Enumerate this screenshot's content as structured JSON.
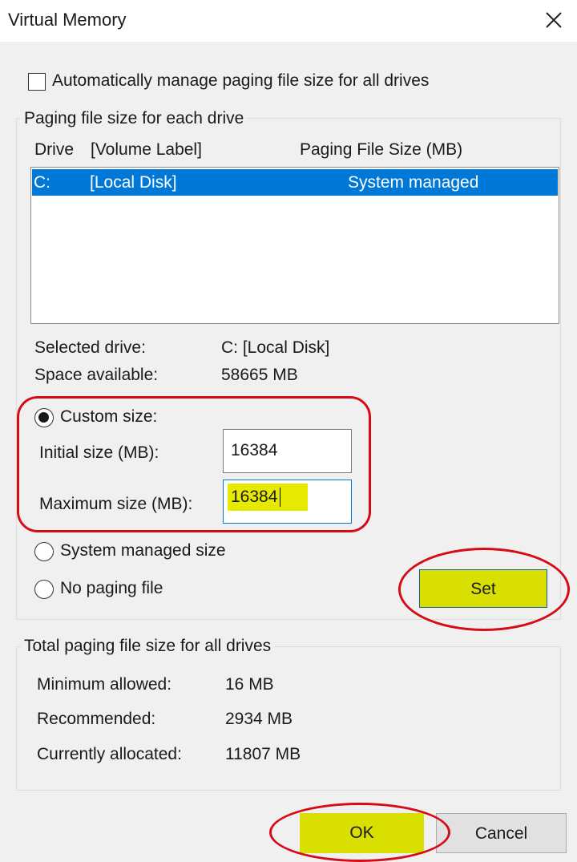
{
  "window": {
    "title": "Virtual Memory",
    "close_icon": "close-icon"
  },
  "auto_manage": {
    "label": "Automatically manage paging file size for all drives",
    "checked": false
  },
  "per_drive": {
    "group_title": "Paging file size for each drive",
    "columns": {
      "drive": "Drive",
      "volume_label": "[Volume Label]",
      "size": "Paging File Size (MB)"
    },
    "rows": [
      {
        "drive": "C:",
        "label": "[Local Disk]",
        "size": "System managed",
        "selected": true
      }
    ],
    "selected_drive_label": "Selected drive:",
    "selected_drive_value": "C:  [Local Disk]",
    "space_available_label": "Space available:",
    "space_available_value": "58665 MB",
    "custom_size_label": "Custom size:",
    "initial_size_label": "Initial size (MB):",
    "initial_size_value": "16384",
    "maximum_size_label": "Maximum size (MB):",
    "maximum_size_value": "16384",
    "system_managed_label": "System managed size",
    "no_paging_label": "No paging file",
    "selected_option": "custom",
    "set_label": "Set"
  },
  "totals": {
    "group_title": "Total paging file size for all drives",
    "minimum_label": "Minimum allowed:",
    "minimum_value": "16 MB",
    "recommended_label": "Recommended:",
    "recommended_value": "2934 MB",
    "allocated_label": "Currently allocated:",
    "allocated_value": "11807 MB"
  },
  "buttons": {
    "ok": "OK",
    "cancel": "Cancel"
  },
  "colors": {
    "highlight": "#e5ea00",
    "annotation": "#d60b16",
    "selection": "#0078d7"
  }
}
